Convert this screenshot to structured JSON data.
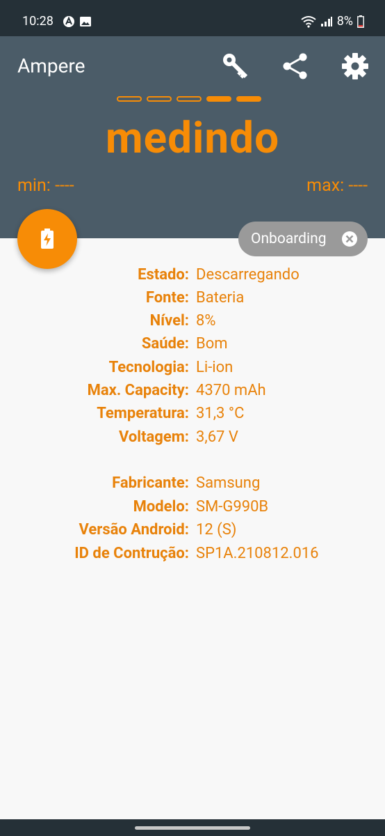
{
  "statusbar": {
    "time": "10:28",
    "battery": "8%"
  },
  "app": {
    "title": "Ampere"
  },
  "header": {
    "status": "medindo",
    "min": "min: ----",
    "max": "max: ----"
  },
  "chip": {
    "label": "Onboarding"
  },
  "info": [
    {
      "k": "Estado:",
      "v": "Descarregando"
    },
    {
      "k": "Fonte:",
      "v": "Bateria"
    },
    {
      "k": "Nível:",
      "v": "8%"
    },
    {
      "k": "Saúde:",
      "v": "Bom"
    },
    {
      "k": "Tecnologia:",
      "v": "Li-ion"
    },
    {
      "k": "Max. Capacity:",
      "v": "4370 mAh"
    },
    {
      "k": "Temperatura:",
      "v": "31,3 °C"
    },
    {
      "k": "Voltagem:",
      "v": "3,67 V"
    }
  ],
  "device": [
    {
      "k": "Fabricante:",
      "v": "Samsung"
    },
    {
      "k": "Modelo:",
      "v": "SM-G990B"
    },
    {
      "k": "Versão Android:",
      "v": "12 (S)"
    },
    {
      "k": "ID de Contrução:",
      "v": "SP1A.210812.016"
    }
  ],
  "colors": {
    "accent": "#f78c06",
    "header": "#4b5c68",
    "statusbar": "#253037"
  }
}
